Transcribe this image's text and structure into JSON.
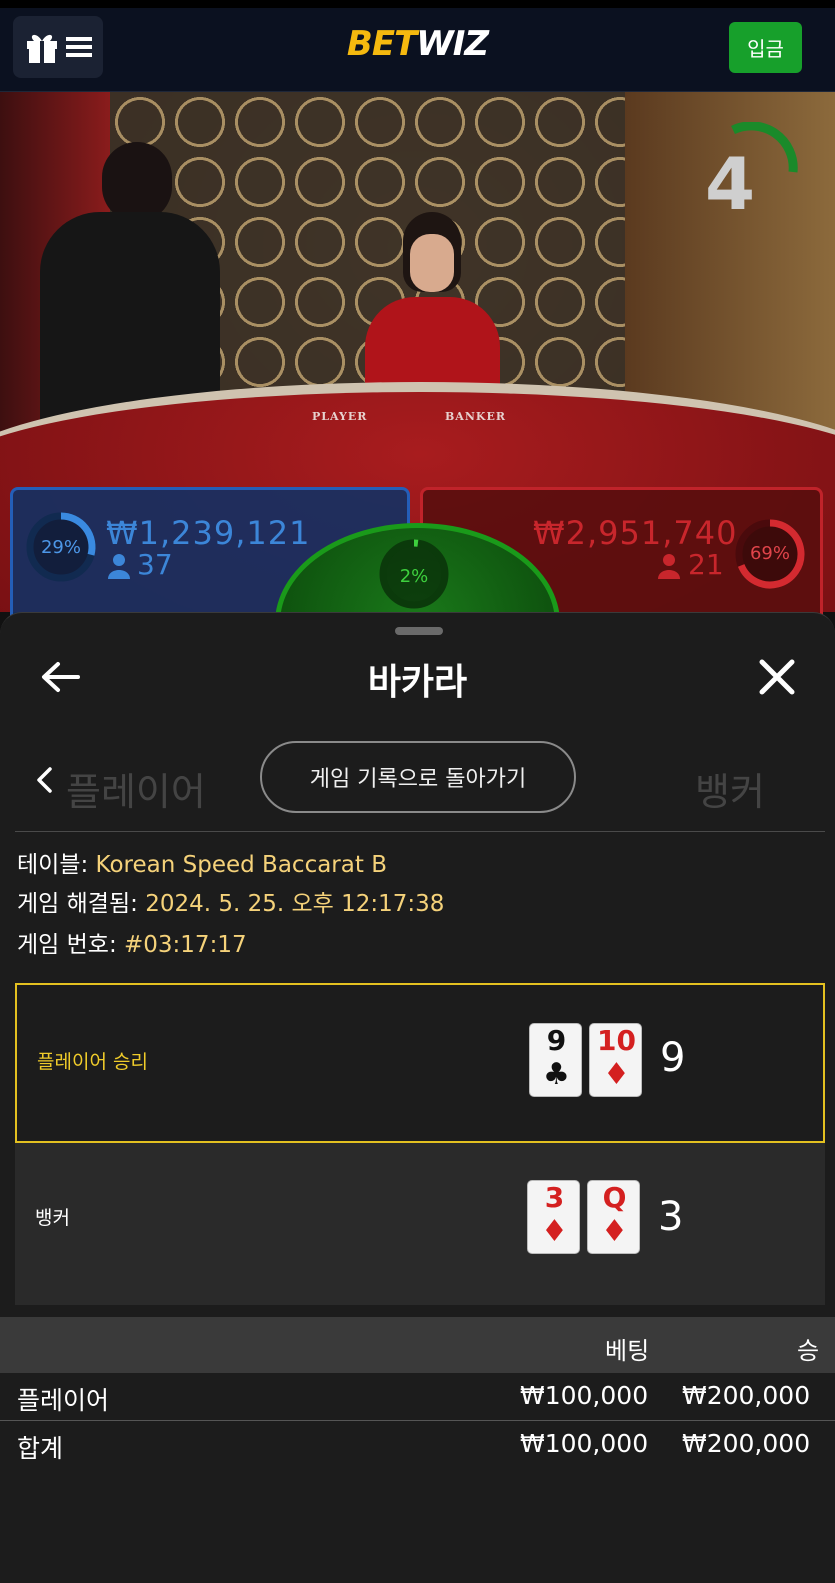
{
  "header": {
    "logo_part1": "BET",
    "logo_part2": "WIZ",
    "deposit_label": "입금"
  },
  "stream": {
    "timer_value": "4",
    "table_label_player": "PLAYER",
    "table_label_banker": "BANKER",
    "player_bet": {
      "percent": "29%",
      "amount": "₩1,239,121",
      "count": "37",
      "percent_value": 0.29
    },
    "banker_bet": {
      "percent": "69%",
      "amount": "₩2,951,740",
      "count": "21",
      "percent_value": 0.69
    },
    "tie_bet": {
      "percent": "2%",
      "percent_value": 0.02
    },
    "colors": {
      "player": "#245eb8",
      "banker": "#c0232a",
      "tie": "#1a9a1a"
    }
  },
  "sheet": {
    "title": "바카라",
    "back_to_history_label": "게임 기록으로 돌아가기",
    "info": {
      "table_label": "테이블:",
      "table_value": "Korean Speed Baccarat B",
      "resolved_label": "게임 해결됨:",
      "resolved_value": "2024. 5. 25. 오후 12:17:38",
      "number_label": "게임 번호:",
      "number_value": "#03:17:17"
    },
    "results": [
      {
        "label": "플레이어 승리",
        "cards": [
          {
            "rank": "9",
            "suit": "♣",
            "color": "#111111"
          },
          {
            "rank": "10",
            "suit": "♦",
            "color": "#d42020"
          }
        ],
        "total": "9"
      },
      {
        "label": "뱅커",
        "cards": [
          {
            "rank": "3",
            "suit": "♦",
            "color": "#d42020"
          },
          {
            "rank": "Q",
            "suit": "♦",
            "color": "#d42020"
          }
        ],
        "total": "3"
      }
    ],
    "bets_table": {
      "headers": {
        "bet": "베팅",
        "win": "승"
      },
      "rows": [
        {
          "name": "플레이어",
          "bet": "₩100,000",
          "win": "₩200,000"
        },
        {
          "name": "합계",
          "bet": "₩100,000",
          "win": "₩200,000"
        }
      ]
    }
  }
}
